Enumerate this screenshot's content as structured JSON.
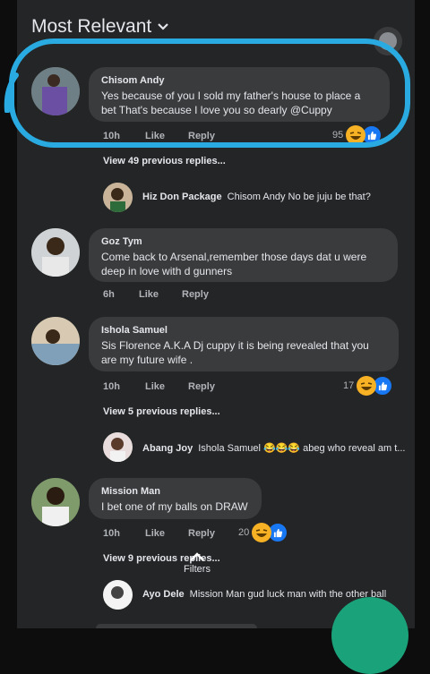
{
  "header": {
    "title": "Most Relevant"
  },
  "comments": [
    {
      "name": "Chisom Andy",
      "text": "Yes because of you I sold my father's house to place a bet That's because I love you so dearly @Cuppy",
      "time": "10h",
      "like": "Like",
      "reply": "Reply",
      "reactions": "95",
      "view_previous": "View 49 previous replies...",
      "latest_reply": {
        "name": "Hiz Don Package",
        "text": "Chisom Andy No be juju be that?"
      }
    },
    {
      "name": "Goz Tym",
      "text": "Come back to Arsenal,remember those days dat u were deep in love with d gunners",
      "time": "6h",
      "like": "Like",
      "reply": "Reply"
    },
    {
      "name": "Ishola Samuel",
      "text": "Sis Florence A.K.A Dj cuppy it is being revealed that you are my future wife .",
      "time": "10h",
      "like": "Like",
      "reply": "Reply",
      "reactions": "17",
      "view_previous": "View 5 previous replies...",
      "latest_reply": {
        "name": "Abang Joy",
        "text": "Ishola Samuel 😂😂😂 abeg who reveal am t..."
      }
    },
    {
      "name": "Mission Man",
      "text": "I bet one of my balls on DRAW",
      "time": "10h",
      "like": "Like",
      "reply": "Reply",
      "reactions": "20",
      "view_previous": "View 9 previous replies...",
      "latest_reply": {
        "name": "Ayo Dele",
        "text": "Mission Man gud luck man with the other ball"
      }
    }
  ],
  "filters_label": "Filters",
  "colors": {
    "panel": "#242526",
    "bubble": "#3a3b3c",
    "highlight": "#29abe2",
    "like_blue": "#1877f2",
    "fab": "#1aa37a"
  }
}
